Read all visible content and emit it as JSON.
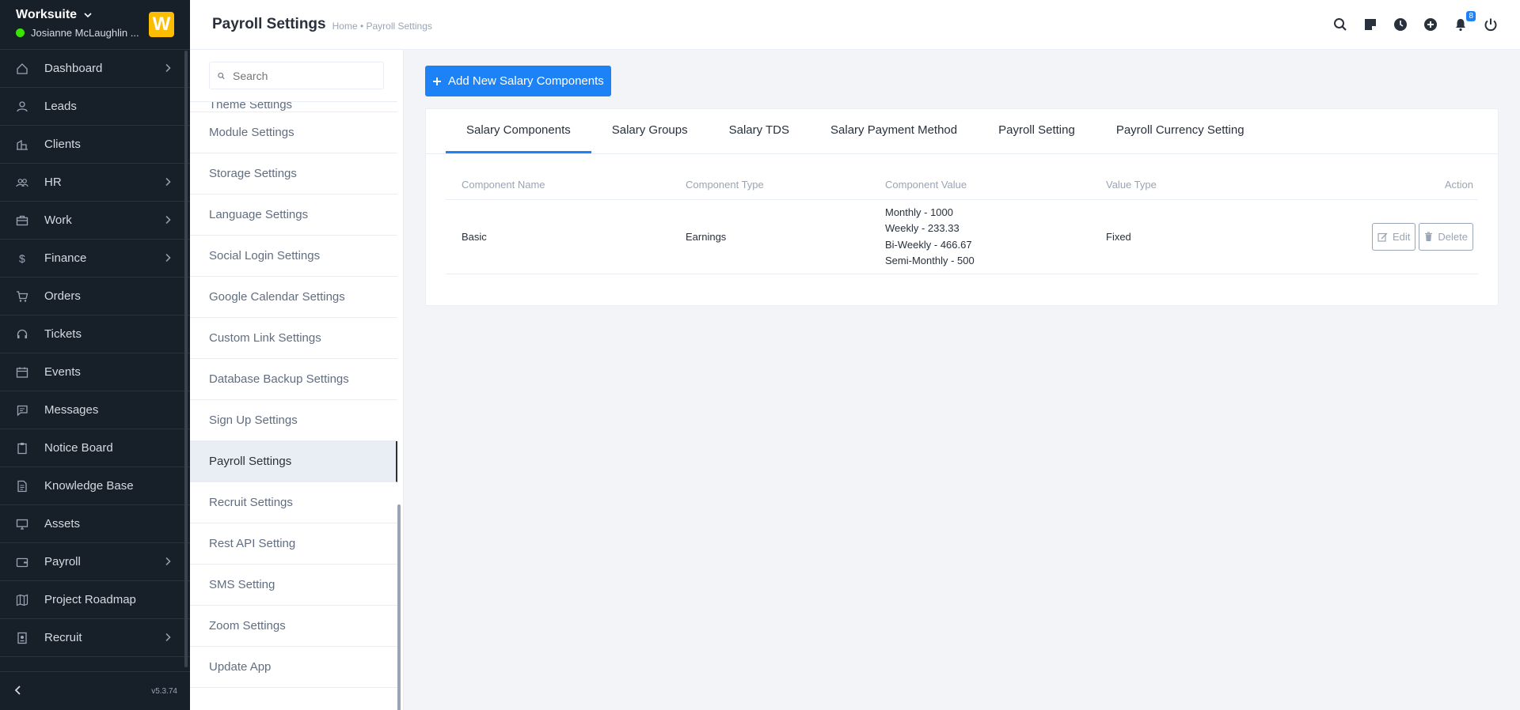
{
  "brand": {
    "name": "Worksuite",
    "user": "Josianne McLaughlin ...",
    "logo_letter": "W",
    "logo_color": "#fcbd01"
  },
  "sidebar": {
    "items": [
      {
        "label": "Dashboard",
        "icon": "home-icon",
        "has_submenu": true
      },
      {
        "label": "Leads",
        "icon": "user-icon",
        "has_submenu": false
      },
      {
        "label": "Clients",
        "icon": "building-icon",
        "has_submenu": false
      },
      {
        "label": "HR",
        "icon": "people-icon",
        "has_submenu": true
      },
      {
        "label": "Work",
        "icon": "briefcase-icon",
        "has_submenu": true
      },
      {
        "label": "Finance",
        "icon": "dollar-icon",
        "has_submenu": true
      },
      {
        "label": "Orders",
        "icon": "cart-icon",
        "has_submenu": false
      },
      {
        "label": "Tickets",
        "icon": "headset-icon",
        "has_submenu": false
      },
      {
        "label": "Events",
        "icon": "calendar-icon",
        "has_submenu": false
      },
      {
        "label": "Messages",
        "icon": "chat-icon",
        "has_submenu": false
      },
      {
        "label": "Notice Board",
        "icon": "clipboard-icon",
        "has_submenu": false
      },
      {
        "label": "Knowledge Base",
        "icon": "document-icon",
        "has_submenu": false
      },
      {
        "label": "Assets",
        "icon": "monitor-icon",
        "has_submenu": false
      },
      {
        "label": "Payroll",
        "icon": "wallet-icon",
        "has_submenu": true
      },
      {
        "label": "Project Roadmap",
        "icon": "map-icon",
        "has_submenu": false
      },
      {
        "label": "Recruit",
        "icon": "id-badge-icon",
        "has_submenu": true
      }
    ],
    "version": "v5.3.74"
  },
  "header": {
    "title": "Payroll Settings",
    "breadcrumb": "Home • Payroll Settings",
    "notification_count": "8"
  },
  "settings_menu": {
    "search_placeholder": "Search",
    "items": [
      {
        "label": "Theme Settings",
        "partial": true
      },
      {
        "label": "Module Settings"
      },
      {
        "label": "Storage Settings"
      },
      {
        "label": "Language Settings"
      },
      {
        "label": "Social Login Settings"
      },
      {
        "label": "Google Calendar Settings"
      },
      {
        "label": "Custom Link Settings"
      },
      {
        "label": "Database Backup Settings"
      },
      {
        "label": "Sign Up Settings"
      },
      {
        "label": "Payroll Settings",
        "active": true
      },
      {
        "label": "Recruit Settings"
      },
      {
        "label": "Rest API Setting"
      },
      {
        "label": "SMS Setting"
      },
      {
        "label": "Zoom Settings"
      },
      {
        "label": "Update App"
      }
    ]
  },
  "main": {
    "add_button": "Add New Salary Components",
    "tabs": [
      "Salary Components",
      "Salary Groups",
      "Salary TDS",
      "Salary Payment Method",
      "Payroll Setting",
      "Payroll Currency Setting"
    ],
    "table": {
      "headers": [
        "Component Name",
        "Component Type",
        "Component Value",
        "Value Type",
        "Action"
      ],
      "rows": [
        {
          "name": "Basic",
          "type": "Earnings",
          "values": [
            "Monthly - 1000",
            "Weekly - 233.33",
            "Bi-Weekly - 466.67",
            "Semi-Monthly - 500"
          ],
          "value_type": "Fixed",
          "edit": "Edit",
          "delete": "Delete"
        }
      ]
    }
  },
  "colors": {
    "accent": "#1d82f5",
    "sidebar_bg": "#171f29",
    "online": "#39e500"
  }
}
